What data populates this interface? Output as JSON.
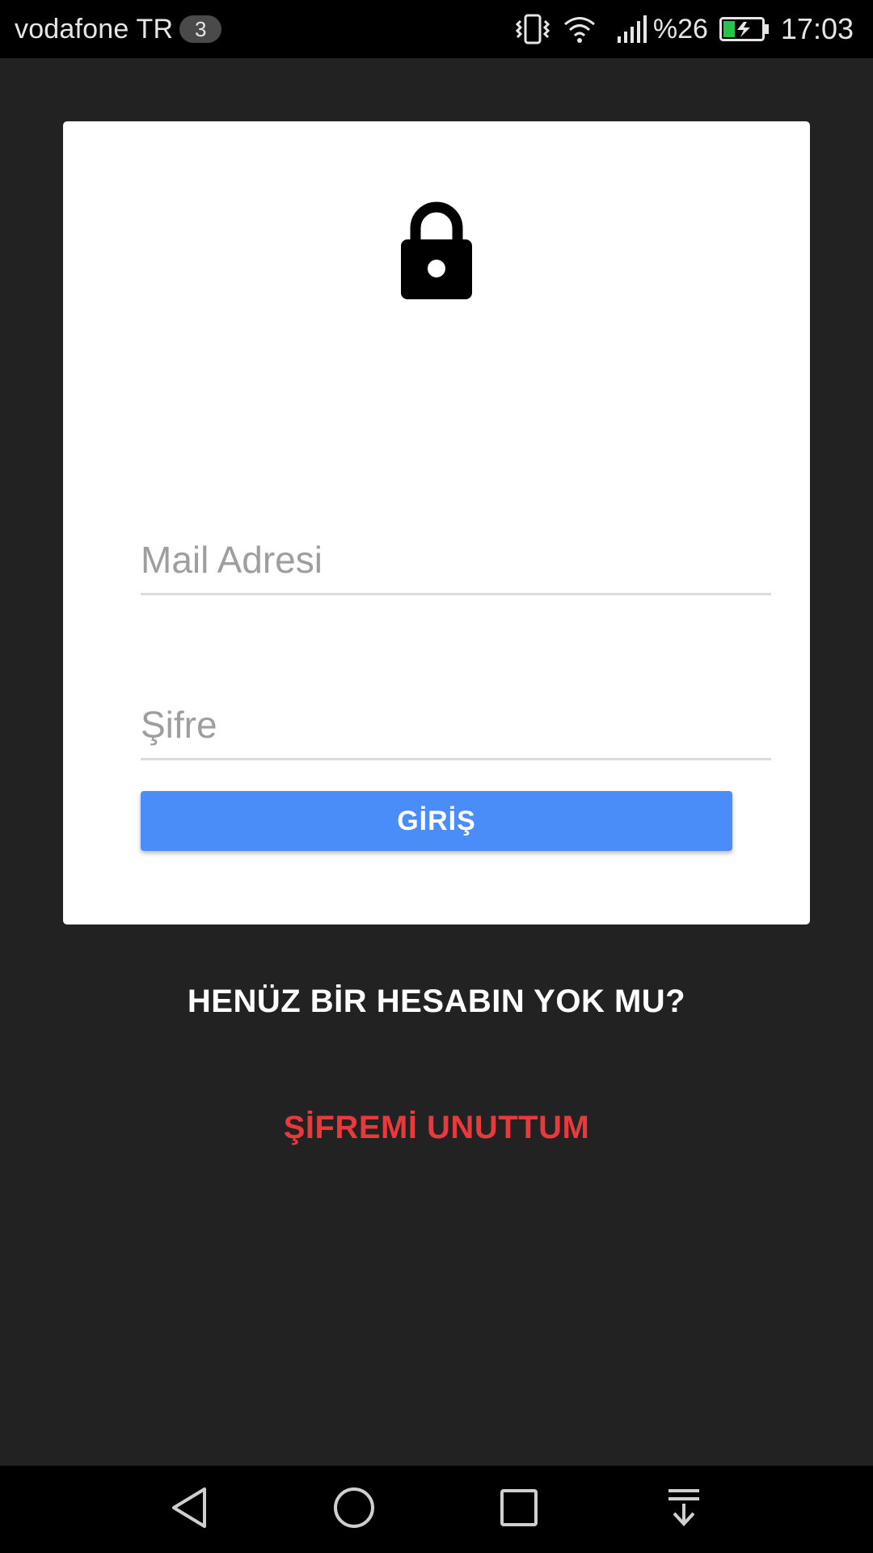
{
  "status_bar": {
    "carrier": "vodafone TR",
    "notification_count": "3",
    "battery_percent": "%26",
    "time": "17:03",
    "icons": [
      "vibrate-icon",
      "wifi-icon",
      "signal-icon",
      "battery-charging-icon"
    ]
  },
  "login_form": {
    "icon": "lock-icon",
    "email_placeholder": "Mail Adresi",
    "email_value": "",
    "password_placeholder": "Şifre",
    "password_value": "",
    "login_label": "GİRİŞ"
  },
  "links": {
    "register_label": "HENÜZ BİR HESABIN YOK MU?",
    "forgot_password_label": "ŞİFREMİ UNUTTUM"
  },
  "nav_bar": {
    "buttons": [
      "back-icon",
      "home-icon",
      "recents-icon",
      "notifications-pull-icon"
    ]
  },
  "colors": {
    "background": "#222222",
    "card": "#ffffff",
    "primary_button": "#4a8cf8",
    "forgot_link": "#e8393d",
    "register_link": "#ffffff"
  }
}
